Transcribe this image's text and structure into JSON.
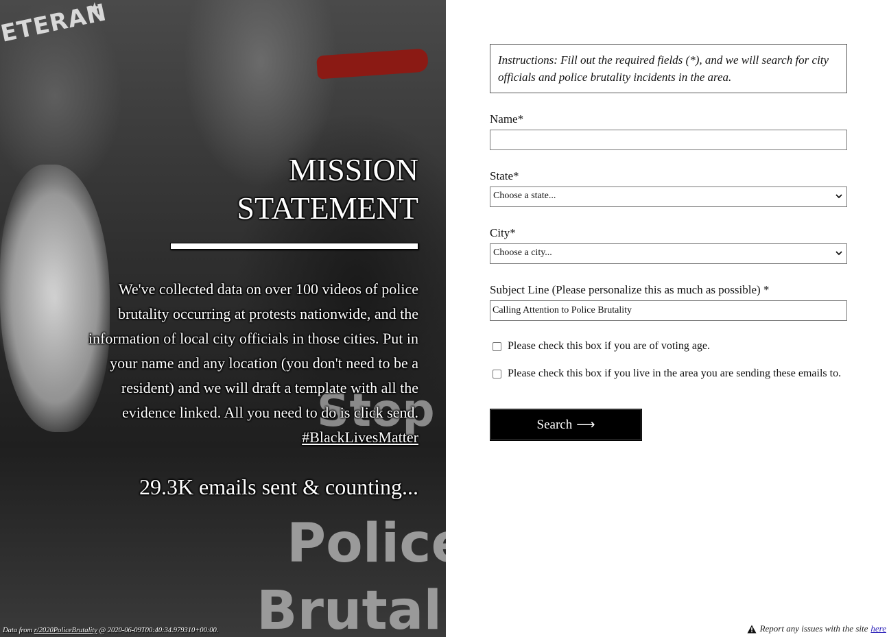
{
  "hero": {
    "background_words": {
      "veteran": "ETERAN",
      "stop": "Stop",
      "police": "Police",
      "brutality": "Brutali"
    },
    "title_line1": "MISSION",
    "title_line2": "STATEMENT",
    "body": "We've collected data on over 100 videos of police brutality occurring at protests nationwide, and the information of local city officials in those cities. Put in your name and any location (you don't need to be a resident) and we will draft a template with all the evidence linked. All you need to do is click send.",
    "hashtag": "#BlackLivesMatter",
    "emails_sent": "29.3K emails sent & counting...",
    "footer": {
      "prefix": "Data from",
      "source_link": "r/2020PoliceBrutality",
      "suffix": "@ 2020-06-09T00:40:34.979310+00:00."
    },
    "accent_color": "#8b1a14"
  },
  "form": {
    "instructions": "Instructions: Fill out the required fields (*), and we will search for city officials and police brutality incidents in the area.",
    "name_label": "Name*",
    "name_value": "",
    "state_label": "State*",
    "state_value": "Choose a state...",
    "city_label": "City*",
    "city_value": "Choose a city...",
    "subject_label": "Subject Line (Please personalize this as much as possible) *",
    "subject_value": "Calling Attention to Police Brutality",
    "checkbox_voting": "Please check this box if you are of voting age.",
    "checkbox_area": "Please check this box if you live in the area you are sending these emails to.",
    "search_label": "Search",
    "search_arrow": "⟶"
  },
  "report": {
    "text": "Report any issues with the site",
    "link": "here",
    "icon": "warning-icon"
  }
}
